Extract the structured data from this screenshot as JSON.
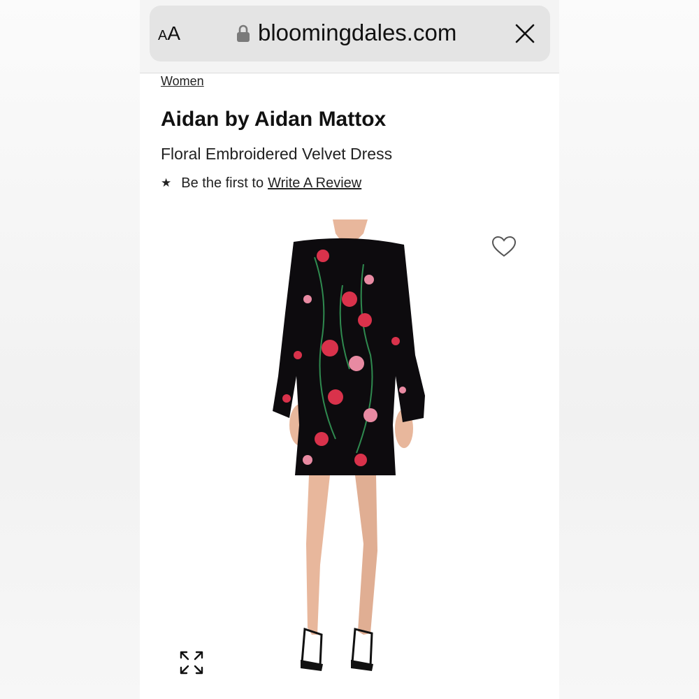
{
  "browser": {
    "text_size_label_small": "A",
    "text_size_label_large": "A",
    "url": "bloomingdales.com",
    "icons": {
      "lock": "lock-icon",
      "close": "close-icon"
    }
  },
  "page": {
    "breadcrumb": "Women",
    "brand": "Aidan by Aidan Mattox",
    "product_name": "Floral Embroidered Velvet Dress",
    "review_prefix": "Be the first to",
    "review_link": "Write A Review",
    "icons": {
      "rating": "star-icon",
      "favorite": "heart-icon",
      "expand": "expand-icon"
    }
  },
  "colors": {
    "dress_base": "#0d0b0e",
    "flower_red": "#d9324b",
    "flower_pink": "#e88aa2",
    "leaf_green": "#2f8a4f",
    "skin": "#e8b79c"
  }
}
